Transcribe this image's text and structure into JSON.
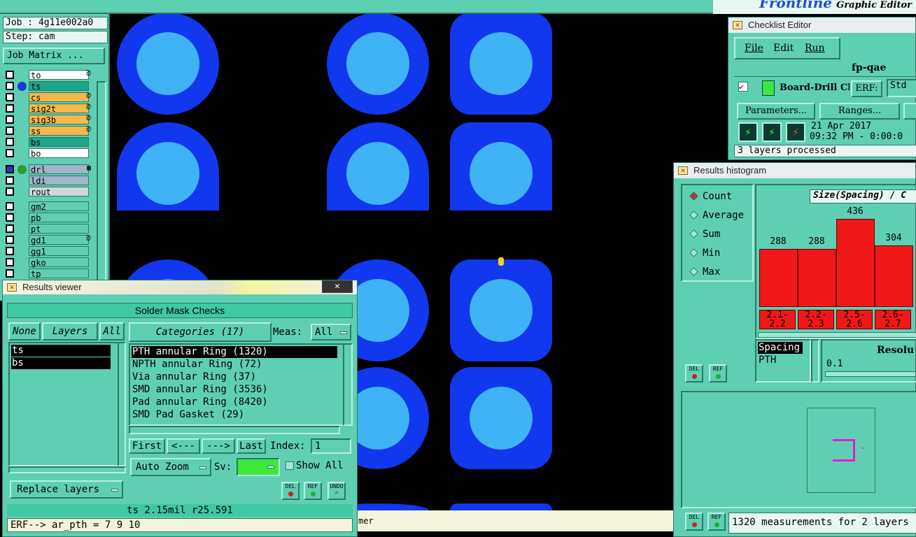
{
  "brand": {
    "logo": "Frontline",
    "title": "Graphic Editor"
  },
  "job": {
    "job_line": "Job : 4g11e002a0",
    "step_line": "Step: cam",
    "matrix_button": "Job Matrix ..."
  },
  "layers": [
    {
      "name": "to",
      "color": "#ffffff",
      "dot": "",
      "leaf": "ᘑ"
    },
    {
      "name": "ts",
      "color": "#1fa58a",
      "dot": "#1a3bd6",
      "leaf": ""
    },
    {
      "name": "cs",
      "color": "#f5b84a",
      "dot": "",
      "leaf": "ᘑ"
    },
    {
      "name": "sig2t",
      "color": "#f5b84a",
      "dot": "",
      "leaf": "ᘑ"
    },
    {
      "name": "sig3b",
      "color": "#f5b84a",
      "dot": "",
      "leaf": "ᘑ"
    },
    {
      "name": "ss",
      "color": "#f5b84a",
      "dot": "",
      "leaf": "ᘑ"
    },
    {
      "name": "bs",
      "color": "#1fa58a",
      "dot": "",
      "leaf": ""
    },
    {
      "name": "bo",
      "color": "#ffffff",
      "dot": "",
      "leaf": ""
    },
    {
      "name": "drl",
      "color": "#9eb6c8",
      "dot": "#2c9c30",
      "leaf": "▦"
    },
    {
      "name": "ldi",
      "color": "#9eb6c8",
      "dot": "",
      "leaf": ""
    },
    {
      "name": "rout",
      "color": "#d0d6da",
      "dot": "",
      "leaf": ""
    },
    {
      "name": "gm2",
      "color": "#5fcfb3",
      "dot": "",
      "leaf": ""
    },
    {
      "name": "pb",
      "color": "#5fcfb3",
      "dot": "",
      "leaf": ""
    },
    {
      "name": "pt",
      "color": "#5fcfb3",
      "dot": "",
      "leaf": ""
    },
    {
      "name": "gd1",
      "color": "#5fcfb3",
      "dot": "",
      "leaf": "ᘑ"
    },
    {
      "name": "gg1",
      "color": "#5fcfb3",
      "dot": "",
      "leaf": ""
    },
    {
      "name": "gko",
      "color": "#5fcfb3",
      "dot": "",
      "leaf": ""
    },
    {
      "name": "tp",
      "color": "#5fcfb3",
      "dot": "",
      "leaf": ""
    }
  ],
  "checklist": {
    "title": "Checklist Editor",
    "menu": [
      "File",
      "Edit",
      "Run"
    ],
    "checklist_name": "fp-qae",
    "action_name": "Board-Drill Che",
    "erf_label": "ERF:",
    "erf_value": "Std",
    "parameters_button": "Parameters...",
    "ranges_button": "Ranges...",
    "date": "21 Apr 2017",
    "time": "09:32 PM - 0:00:0",
    "status": "3 layers processed"
  },
  "viewer": {
    "title": "Results viewer",
    "close": "✕",
    "header": "Solder Mask Checks",
    "none_btn": "None",
    "layers_btn": "Layers",
    "all_btn": "All",
    "categories_btn": "Categories (17)",
    "meas_label": "Meas:",
    "meas_value": "All",
    "layer_items": [
      "ts",
      "bs"
    ],
    "category_items": [
      "PTH annular Ring (1320)",
      "NPTH annular Ring (72)",
      "Via annular Ring (37)",
      "SMD annular Ring (3536)",
      "Pad annular Ring (8420)",
      "SMD Pad Gasket (29)"
    ],
    "nav": {
      "first": "First",
      "prev": "<---",
      "next": "--->",
      "last": "Last",
      "index_label": "Index:",
      "index_value": "1"
    },
    "auto_zoom": "Auto Zoom",
    "sv_label": "Sv:",
    "sv_color": "#3ee83a",
    "show_all": "Show All",
    "replace_layers": "Replace layers",
    "del": "DEL",
    "ref": "REF",
    "undo": "UNDO",
    "status_line": "ts 2.15mil  r25.591",
    "erf_line": "ERF--> ar_pth = 7 9 10",
    "canvas_status": "mer"
  },
  "histogram": {
    "title": "Results histogram",
    "modes": [
      "Count",
      "Average",
      "Sum",
      "Min",
      "Max"
    ],
    "selected_mode": "Count",
    "chart_title": "Size(Spacing) / C",
    "chart_data": {
      "type": "bar",
      "categories": [
        "2.1-\n2.2",
        "2.2-\n2.3",
        "2.5-\n2.6",
        "2.6-\n2.7"
      ],
      "values": [
        288,
        288,
        436,
        304
      ],
      "ylim": [
        0,
        436
      ]
    },
    "measure_list": [
      "Spacing",
      "PTH"
    ],
    "resolution_label": "Resolu",
    "resolution_value": "0.1",
    "footer": "1320 measurements for 2 layers"
  }
}
